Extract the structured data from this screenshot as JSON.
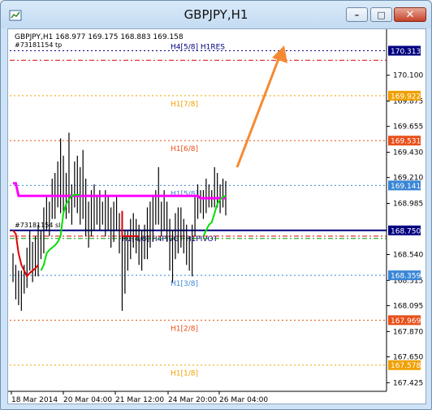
{
  "window": {
    "title": "GBPJPY,H1"
  },
  "header": {
    "symbol_line": "GBPJPY,H1  168.977 169.175 168.883 169.158",
    "order_label": "#73181154 tp",
    "order_label_2": "#73181154 sl"
  },
  "colors": {
    "background": "#ffffff",
    "bars": "#000000",
    "magenta_line": "#ff00ff",
    "green_line": "#00e000",
    "red_line": "#e00000",
    "navy_line": "#000080",
    "arrow": "#f58a32"
  },
  "chart_data": {
    "type": "line",
    "symbol": "GBPJPY",
    "timeframe": "H1",
    "ohlc": {
      "open": 168.977,
      "high": 169.175,
      "low": 168.883,
      "close": 169.158
    },
    "x_tick_labels": [
      "18 Mar 2014",
      "20 Mar 04:00",
      "21 Mar 12:00",
      "24 Mar 20:00",
      "26 Mar 04:00"
    ],
    "y_ticks": [
      {
        "value": 170.1,
        "label": "170.100"
      },
      {
        "value": 169.875,
        "label": "169.875"
      },
      {
        "value": 169.655,
        "label": "169.655"
      },
      {
        "value": 169.43,
        "label": "169.430"
      },
      {
        "value": 169.21,
        "label": "169.210"
      },
      {
        "value": 168.985,
        "label": "168.985"
      },
      {
        "value": 168.54,
        "label": "168.540"
      },
      {
        "value": 168.315,
        "label": "168.315"
      },
      {
        "value": 168.095,
        "label": "168.095"
      },
      {
        "value": 167.87,
        "label": "167.870"
      },
      {
        "value": 167.65,
        "label": "167.650"
      },
      {
        "value": 167.425,
        "label": "167.425"
      }
    ],
    "price_tags": [
      {
        "value": 170.313,
        "label": "170.313",
        "color": "#000080"
      },
      {
        "value": 169.922,
        "label": "169.922",
        "color": "#f0a000"
      },
      {
        "value": 169.531,
        "label": "169.531",
        "color": "#e8501a"
      },
      {
        "value": 169.141,
        "label": "169.141",
        "color": "#3a86d6"
      },
      {
        "value": 168.75,
        "label": "168.750",
        "color": "#000080"
      },
      {
        "value": 168.359,
        "label": "168.359",
        "color": "#3a86d6"
      },
      {
        "value": 167.969,
        "label": "167.969",
        "color": "#e8501a"
      },
      {
        "value": 167.578,
        "label": "167.578",
        "color": "#f0a000"
      }
    ],
    "murrey_levels": [
      {
        "label": "H4[5/8] H1RES",
        "value": 170.313,
        "color": "#000080"
      },
      {
        "label": "H1[7/8]",
        "value": 169.922,
        "color": "#f0a000"
      },
      {
        "label": "H1[6/8]",
        "value": 169.531,
        "color": "#e8501a"
      },
      {
        "label": "H1[5/8]",
        "value": 169.141,
        "color": "#3a86d6"
      },
      {
        "label": "H1[4/8] H4PIVOT H1PIVOT",
        "value": 168.75,
        "color": "#000080"
      },
      {
        "label": "H1[3/8]",
        "value": 168.359,
        "color": "#3a86d6"
      },
      {
        "label": "H1[2/8]",
        "value": 167.969,
        "color": "#e8501a"
      },
      {
        "label": "H1[1/8]",
        "value": 167.578,
        "color": "#f0a000"
      }
    ],
    "extra_lines": [
      {
        "name": "tp",
        "value": 170.23,
        "color": "#e00000"
      },
      {
        "name": "sl",
        "value": 168.7,
        "color": "#e00000"
      },
      {
        "name": "sl2",
        "value": 168.68,
        "color": "#00a000"
      }
    ],
    "ylim": [
      167.35,
      170.5
    ],
    "bars": [
      [
        168.3,
        168.55
      ],
      [
        168.15,
        168.45
      ],
      [
        168.1,
        168.4
      ],
      [
        168.05,
        168.4
      ],
      [
        168.2,
        168.45
      ],
      [
        168.25,
        168.6
      ],
      [
        168.4,
        168.75
      ],
      [
        168.3,
        168.65
      ],
      [
        168.35,
        168.7
      ],
      [
        168.35,
        168.8
      ],
      [
        168.5,
        168.75
      ],
      [
        168.55,
        168.95
      ],
      [
        168.75,
        169.05
      ],
      [
        168.7,
        169.0
      ],
      [
        168.85,
        169.2
      ],
      [
        168.85,
        169.25
      ],
      [
        168.95,
        169.35
      ],
      [
        168.9,
        169.55
      ],
      [
        168.9,
        169.4
      ],
      [
        168.85,
        169.25
      ],
      [
        168.9,
        169.6
      ],
      [
        168.8,
        169.15
      ],
      [
        168.95,
        169.35
      ],
      [
        168.9,
        169.4
      ],
      [
        168.8,
        169.3
      ],
      [
        168.85,
        169.45
      ],
      [
        168.7,
        169.2
      ],
      [
        168.6,
        169.0
      ],
      [
        168.7,
        169.1
      ],
      [
        168.75,
        169.15
      ],
      [
        168.8,
        169.05
      ],
      [
        168.75,
        169.1
      ],
      [
        168.8,
        169.0
      ],
      [
        168.7,
        169.1
      ],
      [
        168.75,
        169.05
      ],
      [
        168.6,
        168.95
      ],
      [
        168.65,
        169.0
      ],
      [
        168.75,
        169.05
      ],
      [
        168.55,
        168.9
      ],
      [
        168.05,
        168.8
      ],
      [
        168.2,
        168.75
      ],
      [
        168.4,
        168.75
      ],
      [
        168.5,
        168.85
      ],
      [
        168.6,
        168.9
      ],
      [
        168.55,
        168.85
      ],
      [
        168.45,
        168.8
      ],
      [
        168.4,
        168.75
      ],
      [
        168.5,
        168.8
      ],
      [
        168.5,
        168.95
      ],
      [
        168.6,
        169.0
      ],
      [
        168.65,
        169.05
      ],
      [
        168.8,
        169.1
      ],
      [
        168.8,
        169.3
      ],
      [
        168.7,
        169.0
      ],
      [
        168.75,
        169.1
      ],
      [
        168.65,
        169.0
      ],
      [
        168.4,
        168.85
      ],
      [
        168.3,
        168.75
      ],
      [
        168.5,
        168.9
      ],
      [
        168.55,
        168.95
      ],
      [
        168.6,
        168.95
      ],
      [
        168.55,
        168.85
      ],
      [
        168.45,
        168.8
      ],
      [
        168.4,
        168.7
      ],
      [
        168.35,
        168.8
      ],
      [
        168.7,
        169.05
      ],
      [
        168.85,
        169.15
      ],
      [
        168.9,
        169.1
      ],
      [
        168.85,
        169.1
      ],
      [
        168.9,
        169.2
      ],
      [
        168.95,
        169.15
      ],
      [
        168.95,
        169.1
      ],
      [
        168.95,
        169.3
      ],
      [
        168.95,
        169.25
      ],
      [
        168.9,
        169.15
      ],
      [
        168.95,
        169.2
      ],
      [
        168.88,
        169.18
      ]
    ],
    "magenta": [
      169.16,
      169.16,
      169.05,
      169.05,
      169.05,
      169.05,
      169.05,
      169.05,
      169.05,
      169.05,
      169.05,
      169.05,
      169.05,
      169.05,
      169.05,
      169.05,
      169.05,
      169.05,
      169.05,
      169.05,
      169.05,
      169.05,
      169.05,
      169.05,
      169.05,
      169.05,
      169.05,
      169.05,
      169.05,
      169.05,
      169.05,
      169.05,
      169.05,
      169.05,
      169.05,
      169.05,
      169.05,
      169.05,
      169.05,
      169.05,
      169.05,
      169.05,
      169.05,
      169.05,
      169.05,
      169.05,
      169.05,
      169.05,
      169.05,
      169.05,
      169.05,
      169.05,
      169.05,
      169.05,
      169.05,
      169.05,
      169.05,
      169.05,
      169.05,
      169.05,
      169.05,
      169.05,
      169.05,
      169.05,
      169.05,
      169.05,
      169.05,
      169.03,
      169.03,
      169.03,
      169.03,
      169.03,
      169.03,
      169.03,
      169.03,
      169.03,
      169.03
    ],
    "green_start": 10,
    "green": [
      168.4,
      168.45,
      168.55,
      168.58,
      168.6,
      168.62,
      168.65,
      168.7,
      168.9,
      168.98,
      169.02,
      169.05,
      169.06,
      169.06,
      169.06
    ],
    "red": [
      168.75,
      168.72,
      168.55,
      168.45,
      168.4,
      168.35,
      168.38,
      168.4,
      168.42,
      168.45
    ]
  }
}
